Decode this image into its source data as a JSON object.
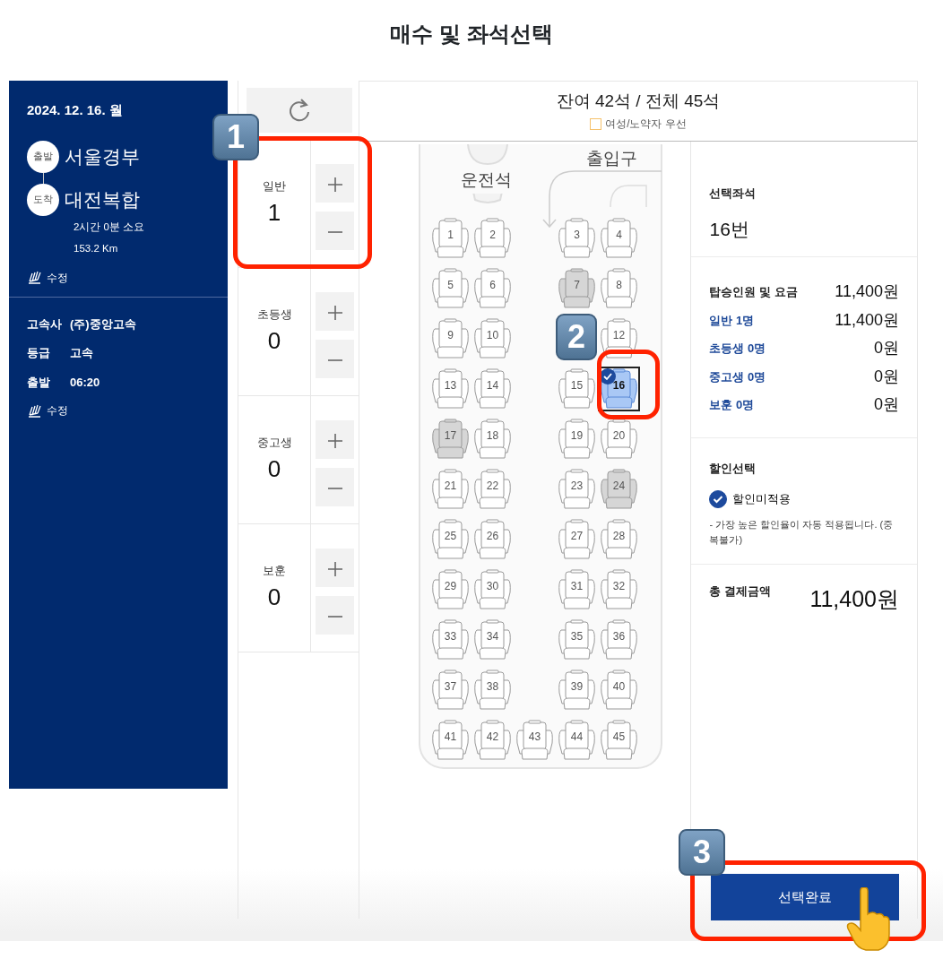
{
  "title": "매수 및 좌석선택",
  "trip": {
    "date": "2024. 12. 16. 월",
    "departure": {
      "badge": "출발",
      "name": "서울경부"
    },
    "arrival": {
      "badge": "도착",
      "name": "대전복합"
    },
    "duration": "2시간 0분 소요",
    "distance": "153.2 Km",
    "edit": "수정"
  },
  "bus_info": {
    "rows": [
      {
        "label": "고속사",
        "value": "(주)중앙고속"
      },
      {
        "label": "등급",
        "value": "고속"
      },
      {
        "label": "출발",
        "value": "06:20"
      }
    ],
    "edit": "수정"
  },
  "passengers": [
    {
      "label": "일반",
      "count": "1"
    },
    {
      "label": "초등생",
      "count": "0"
    },
    {
      "label": "중고생",
      "count": "0"
    },
    {
      "label": "보훈",
      "count": "0"
    }
  ],
  "seat_map": {
    "remaining": "잔여 42석 / 전체 45석",
    "legend": "여성/노약자 우선",
    "driver": "운전석",
    "entrance": "출입구",
    "rows": [
      [
        {
          "number": "1",
          "kind": "available"
        },
        {
          "number": "2",
          "kind": "available"
        },
        {
          "kind": "aisle"
        },
        {
          "number": "3",
          "kind": "available"
        },
        {
          "number": "4",
          "kind": "available"
        }
      ],
      [
        {
          "number": "5",
          "kind": "available"
        },
        {
          "number": "6",
          "kind": "available"
        },
        {
          "kind": "aisle"
        },
        {
          "number": "7",
          "kind": "occupied"
        },
        {
          "number": "8",
          "kind": "available"
        }
      ],
      [
        {
          "number": "9",
          "kind": "available"
        },
        {
          "number": "10",
          "kind": "available"
        },
        {
          "kind": "aisle"
        },
        {
          "kind": "covered"
        },
        {
          "number": "12",
          "kind": "available"
        }
      ],
      [
        {
          "number": "13",
          "kind": "available"
        },
        {
          "number": "14",
          "kind": "available"
        },
        {
          "kind": "aisle"
        },
        {
          "number": "15",
          "kind": "available"
        },
        {
          "number": "16",
          "kind": "selected"
        }
      ],
      [
        {
          "number": "17",
          "kind": "occupied"
        },
        {
          "number": "18",
          "kind": "available"
        },
        {
          "kind": "aisle"
        },
        {
          "number": "19",
          "kind": "available"
        },
        {
          "number": "20",
          "kind": "available"
        }
      ],
      [
        {
          "number": "21",
          "kind": "available"
        },
        {
          "number": "22",
          "kind": "available"
        },
        {
          "kind": "aisle"
        },
        {
          "number": "23",
          "kind": "available"
        },
        {
          "number": "24",
          "kind": "occupied"
        }
      ],
      [
        {
          "number": "25",
          "kind": "available"
        },
        {
          "number": "26",
          "kind": "available"
        },
        {
          "kind": "aisle"
        },
        {
          "number": "27",
          "kind": "available"
        },
        {
          "number": "28",
          "kind": "available"
        }
      ],
      [
        {
          "number": "29",
          "kind": "available"
        },
        {
          "number": "30",
          "kind": "available"
        },
        {
          "kind": "aisle"
        },
        {
          "number": "31",
          "kind": "available"
        },
        {
          "number": "32",
          "kind": "available"
        }
      ],
      [
        {
          "number": "33",
          "kind": "available"
        },
        {
          "number": "34",
          "kind": "available"
        },
        {
          "kind": "aisle"
        },
        {
          "number": "35",
          "kind": "available"
        },
        {
          "number": "36",
          "kind": "available"
        }
      ],
      [
        {
          "number": "37",
          "kind": "available"
        },
        {
          "number": "38",
          "kind": "available"
        },
        {
          "kind": "aisle"
        },
        {
          "number": "39",
          "kind": "available"
        },
        {
          "number": "40",
          "kind": "available"
        }
      ],
      [
        {
          "number": "41",
          "kind": "available"
        },
        {
          "number": "42",
          "kind": "available"
        },
        {
          "number": "43",
          "kind": "available"
        },
        {
          "number": "44",
          "kind": "available"
        },
        {
          "number": "45",
          "kind": "available"
        }
      ]
    ]
  },
  "summary": {
    "seat_label": "선택좌석",
    "seat_value": "16번",
    "fare_title": "탑승인원 및 요금",
    "fare_total": "11,400원",
    "fares": [
      {
        "label": "일반 1명",
        "amount": "11,400원"
      },
      {
        "label": "초등생 0명",
        "amount": "0원"
      },
      {
        "label": "중고생 0명",
        "amount": "0원"
      },
      {
        "label": "보훈 0명",
        "amount": "0원"
      }
    ],
    "discount_title": "할인선택",
    "discount_option": {
      "label": "할인미적용",
      "checked": true
    },
    "discount_note": "- 가장 높은 할인율이 자동 적용됩니다. (중복불가)",
    "total_label": "총 결제금액",
    "total_value": "11,400원"
  },
  "confirm_button": "선택완료",
  "callouts": [
    {
      "number": "1"
    },
    {
      "number": "2"
    },
    {
      "number": "3"
    }
  ]
}
